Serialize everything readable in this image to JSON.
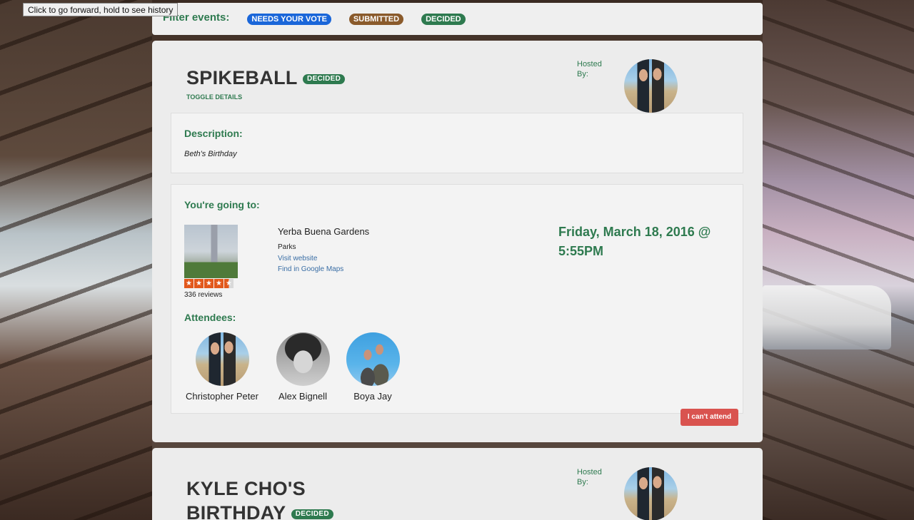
{
  "browser": {
    "tooltip": "Click to go forward, hold to see history"
  },
  "filter": {
    "title": "Filter events:",
    "pills": [
      {
        "label": "NEEDS YOUR VOTE",
        "color": "#1a66d9"
      },
      {
        "label": "SUBMITTED",
        "color": "#8a5a2b"
      },
      {
        "label": "DECIDED",
        "color": "#2e7a4f"
      }
    ]
  },
  "events": [
    {
      "title": "SPIKEBALL",
      "status": "DECIDED",
      "toggle": "TOGGLE DETAILS",
      "hosted_by": "Hosted By:",
      "description_heading": "Description:",
      "description": "Beth's Birthday",
      "going_heading": "You're going to:",
      "venue": {
        "name": "Yerba Buena Gardens",
        "category": "Parks",
        "website_link": "Visit website",
        "maps_link": "Find in Google Maps",
        "rating": 4.5,
        "reviews": "336 reviews"
      },
      "date": "Friday, March 18, 2016 @ 5:55PM",
      "attendees_heading": "Attendees:",
      "attendees": [
        {
          "name": "Christopher Peter"
        },
        {
          "name": "Alex Bignell"
        },
        {
          "name": "Boya Jay"
        }
      ],
      "cant_attend": "I can't attend"
    },
    {
      "title_line1": "KYLE CHO'S",
      "title_line2": "BIRTHDAY",
      "status": "DECIDED",
      "hosted_by": "Hosted By:"
    }
  ],
  "colors": {
    "accent_green": "#2e7a4f",
    "danger_red": "#d9534f",
    "link_blue": "#3a6ea5"
  }
}
